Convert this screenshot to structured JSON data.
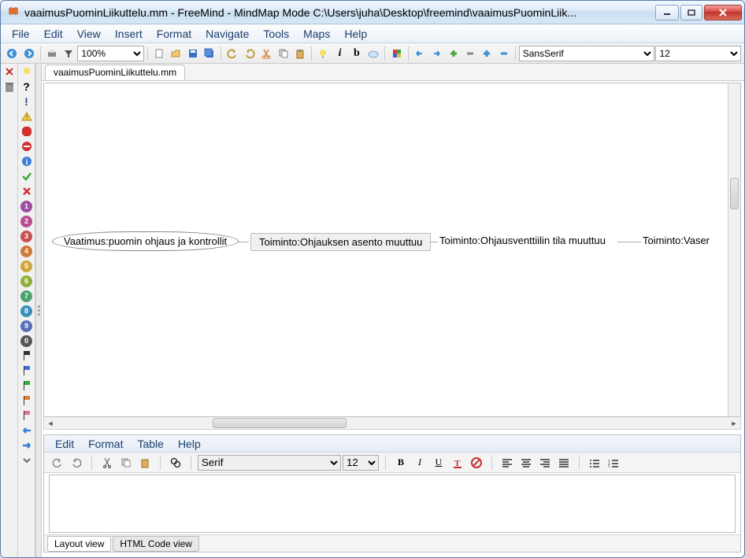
{
  "window": {
    "title": "vaaimusPuominLiikuttelu.mm - FreeMind - MindMap Mode C:\\Users\\juha\\Desktop\\freemind\\vaaimusPuominLiik..."
  },
  "menubar": [
    "File",
    "Edit",
    "View",
    "Insert",
    "Format",
    "Navigate",
    "Tools",
    "Maps",
    "Help"
  ],
  "toolbar": {
    "zoom": "100%",
    "font_family": "SansSerif",
    "font_size": "12"
  },
  "tabs": {
    "active": "vaaimusPuominLiikuttelu.mm"
  },
  "mindmap": {
    "root": "Vaatimus:puomin ohjaus ja kontrollit",
    "n1": "Toiminto:Ohjauksen asento muuttuu",
    "n2": "Toiminto:Ohjausventtiilin tila muuttuu",
    "n3": "Toiminto:Vaser"
  },
  "editor": {
    "menubar": [
      "Edit",
      "Format",
      "Table",
      "Help"
    ],
    "font_family": "Serif",
    "font_size": "12",
    "tabs": {
      "layout": "Layout view",
      "html": "HTML Code view"
    }
  },
  "icon_numbers": [
    "1",
    "2",
    "3",
    "4",
    "5",
    "6",
    "7",
    "8",
    "9",
    "0"
  ],
  "colors": {
    "num_bg": [
      "#9c4ea3",
      "#b84b8f",
      "#c85050",
      "#d07a3a",
      "#d0a43a",
      "#8fae3a",
      "#4aa36a",
      "#3a8fb8",
      "#5a6eb8",
      "#555555"
    ]
  }
}
